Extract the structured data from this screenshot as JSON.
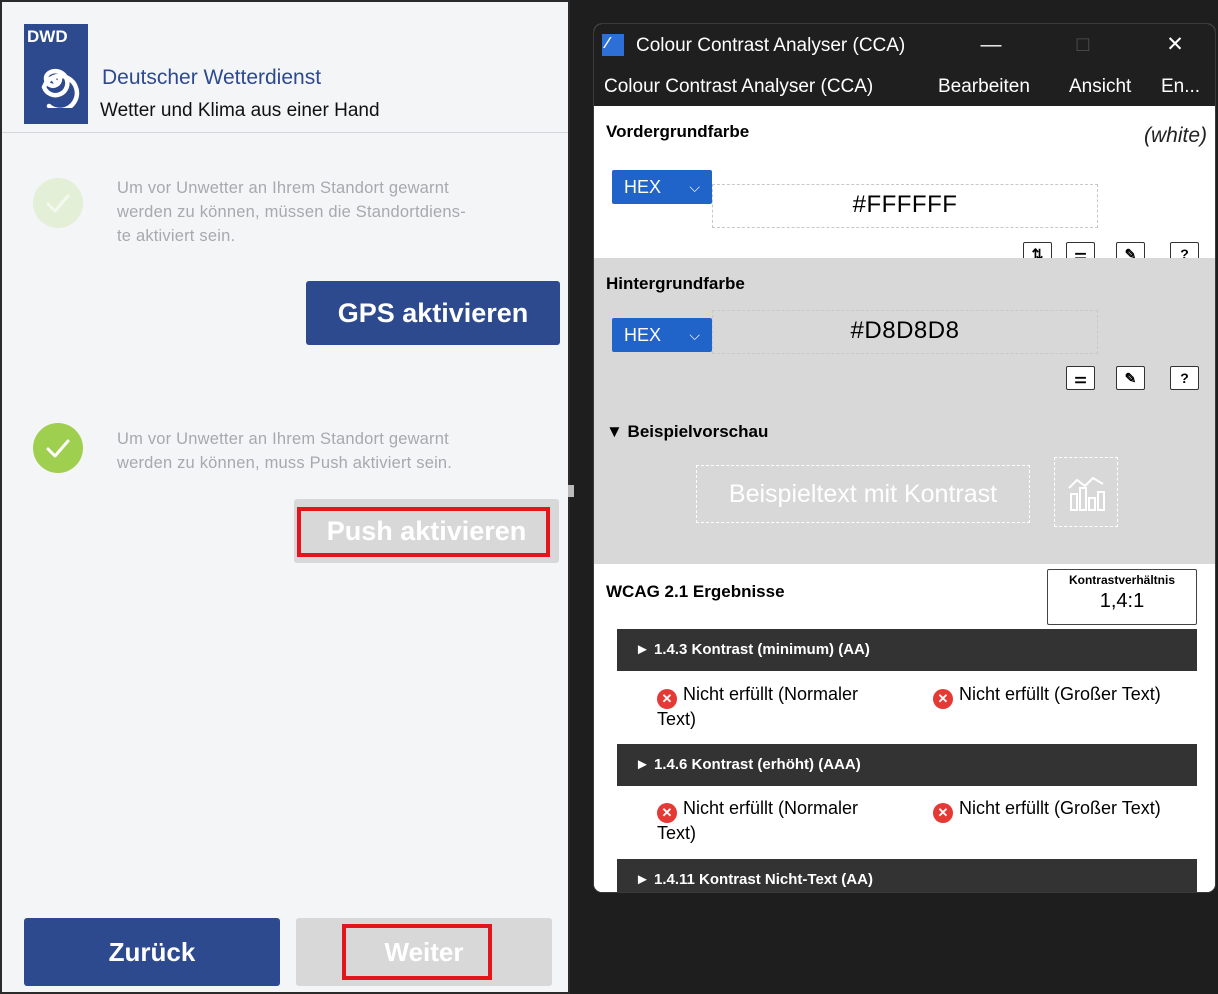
{
  "dwd": {
    "logo_abbr": "DWD",
    "title": "Deutscher Wetterdienst",
    "subtitle": "Wetter und Klima aus einer Hand",
    "gps": {
      "text_lines": [
        "Um vor Unwetter an Ihrem Standort gewarnt",
        "werden zu können, müssen die Standortdiens-",
        "te aktiviert sein."
      ],
      "button": "GPS aktivieren"
    },
    "push": {
      "text_lines": [
        "Um vor Unwetter an Ihrem Standort gewarnt",
        "werden zu können, muss Push aktiviert sein."
      ],
      "button": "Push aktivieren"
    },
    "back_button": "Zurück",
    "next_button": "Weiter",
    "colors": {
      "brand": "#2d4a8f",
      "check_active": "#9fcf4e",
      "check_inactive": "#e3efd7",
      "highlight": "#e3161d"
    }
  },
  "cca": {
    "window_title": "Colour Contrast Analyser (CCA)",
    "window_controls": {
      "minimize": "—",
      "maximize": "□",
      "close": "✕"
    },
    "menu": {
      "app": "Colour Contrast Analyser (CCA)",
      "edit": "Bearbeiten",
      "view": "Ansicht",
      "more": "En..."
    },
    "foreground": {
      "label": "Vordergrundfarbe",
      "color_name": "(white)",
      "format": "HEX",
      "value": "#FFFFFF"
    },
    "background": {
      "label": "Hintergrundfarbe",
      "format": "HEX",
      "value": "#D8D8D8"
    },
    "preview": {
      "label": "▼ Beispielvorschau",
      "sample_text": "Beispieltext mit Kontrast"
    },
    "wcag": {
      "label": "WCAG 2.1 Ergebnisse",
      "ratio_label": "Kontrastverhältnis",
      "ratio_value": "1,4:1",
      "criteria": [
        {
          "title": "► 1.4.3 Kontrast (minimum) (AA)",
          "result_normal": "Nicht erfüllt (Normaler",
          "result_normal_2": "Text)",
          "result_large": "Nicht erfüllt (Großer Text)"
        },
        {
          "title": "► 1.4.6 Kontrast (erhöht) (AAA)",
          "result_normal": "Nicht erfüllt (Normaler",
          "result_normal_2": "Text)",
          "result_large": "Nicht erfüllt (Großer Text)"
        },
        {
          "title": "► 1.4.11 Kontrast Nicht-Text (AA)"
        }
      ]
    }
  }
}
